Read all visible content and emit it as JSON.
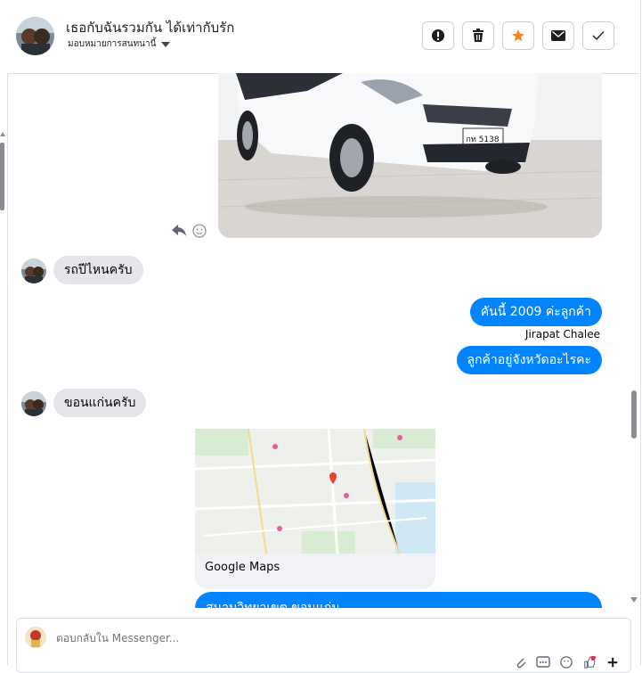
{
  "header": {
    "title": "เธอกับฉันรวมกัน ได้เท่ากับรัก",
    "assign_label": "มอบหมายการสนทนานี้"
  },
  "actions": [
    {
      "icon": "alert-circle-icon",
      "name": "mark-spam-button"
    },
    {
      "icon": "trash-icon",
      "name": "delete-button"
    },
    {
      "icon": "star-icon",
      "name": "star-button",
      "color": "#f5821f"
    },
    {
      "icon": "envelope-icon",
      "name": "mark-unread-button"
    },
    {
      "icon": "checkmark-icon",
      "name": "mark-done-button"
    }
  ],
  "messages": {
    "m1": "รถปีไหนครับ",
    "m2": "คันนี้ 2009 ค่ะลูกค้า",
    "m2_sender": "Jirapat Chalee",
    "m3": "ลูกค้าอยู่จังหวัดอะไรคะ",
    "m4": "ขอนแก่นครับ",
    "map_label": "Google Maps",
    "partial": "สนามวิทยาเขต ขอนแก่น"
  },
  "photo": {
    "plate_text": "กท 5138"
  },
  "composer": {
    "placeholder": "ตอบกลับใน Messenger..."
  },
  "colors": {
    "outgoing": "#0084ff",
    "incoming": "#e4e6eb",
    "star": "#f5821f"
  }
}
